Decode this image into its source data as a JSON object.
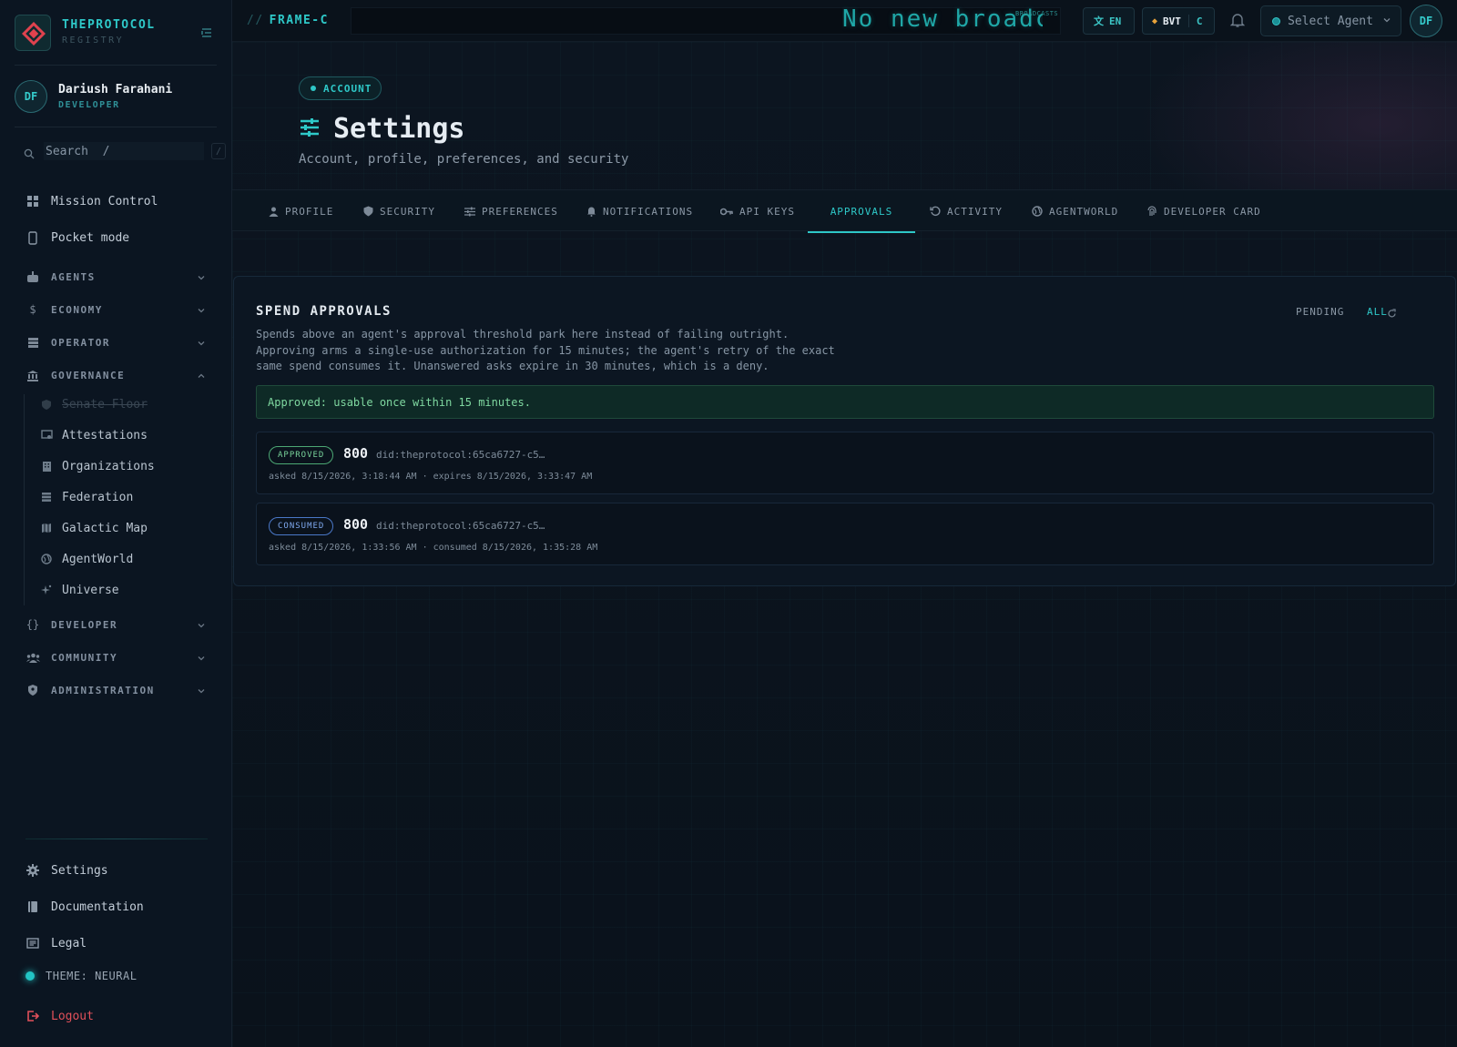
{
  "brand": {
    "name": "THEPROTOCOL",
    "sub": "REGISTRY"
  },
  "user": {
    "initials": "DF",
    "name": "Dariush Farahani",
    "role": "DEVELOPER"
  },
  "search": {
    "placeholder": "Search  /",
    "shortcut": "/"
  },
  "nav": {
    "mission_control": "Mission Control",
    "pocket_mode": "Pocket mode",
    "agents": "AGENTS",
    "economy": "ECONOMY",
    "operator": "OPERATOR",
    "governance": "GOVERNANCE",
    "governance_items": {
      "senate_floor": "Senate Floor",
      "attestations": "Attestations",
      "organizations": "Organizations",
      "federation": "Federation",
      "galactic_map": "Galactic Map",
      "agentworld": "AgentWorld",
      "universe": "Universe"
    },
    "developer": "DEVELOPER",
    "community": "COMMUNITY",
    "administration": "ADMINISTRATION",
    "settings": "Settings",
    "documentation": "Documentation",
    "legal": "Legal",
    "theme": "THEME: NEURAL",
    "logout": "Logout"
  },
  "topbar": {
    "frame": "FRAME-C",
    "slashes": "//",
    "ticker": "No new broadc",
    "ticker_tag": "BROADCASTS",
    "lang": "EN",
    "currency": "BVT",
    "currency_suffix": "C",
    "agent_select": "Select Agent",
    "avatar": "DF"
  },
  "header": {
    "badge": "ACCOUNT",
    "title": "Settings",
    "subtitle": "Account, profile, preferences, and security"
  },
  "tabs": {
    "profile": "PROFILE",
    "security": "SECURITY",
    "preferences": "PREFERENCES",
    "notifications": "NOTIFICATIONS",
    "api_keys": "API KEYS",
    "approvals": "APPROVALS",
    "activity": "ACTIVITY",
    "agentworld": "AGENTWORLD",
    "developer_card": "DEVELOPER CARD"
  },
  "approvals": {
    "title": "SPEND APPROVALS",
    "description": "Spends above an agent's approval threshold park here instead of failing outright. Approving arms a single-use authorization for 15 minutes; the agent's retry of the exact same spend consumes it. Unanswered asks expire in 30 minutes, which is a deny.",
    "filter_pending": "PENDING",
    "filter_all": "ALL",
    "notice": "Approved: usable once within 15 minutes.",
    "requests": [
      {
        "status": "APPROVED",
        "amount": "800",
        "did": "did:theprotocol:65ca6727-c5…",
        "meta": "asked 8/15/2026, 3:18:44 AM · expires 8/15/2026, 3:33:47 AM"
      },
      {
        "status": "CONSUMED",
        "amount": "800",
        "did": "did:theprotocol:65ca6727-c5…",
        "meta": "asked 8/15/2026, 1:33:56 AM · consumed 8/15/2026, 1:35:28 AM"
      }
    ]
  },
  "colors": {
    "accent": "#2ec8c8",
    "background": "#0a121c",
    "danger": "#e2505a",
    "success": "#79d49b"
  }
}
